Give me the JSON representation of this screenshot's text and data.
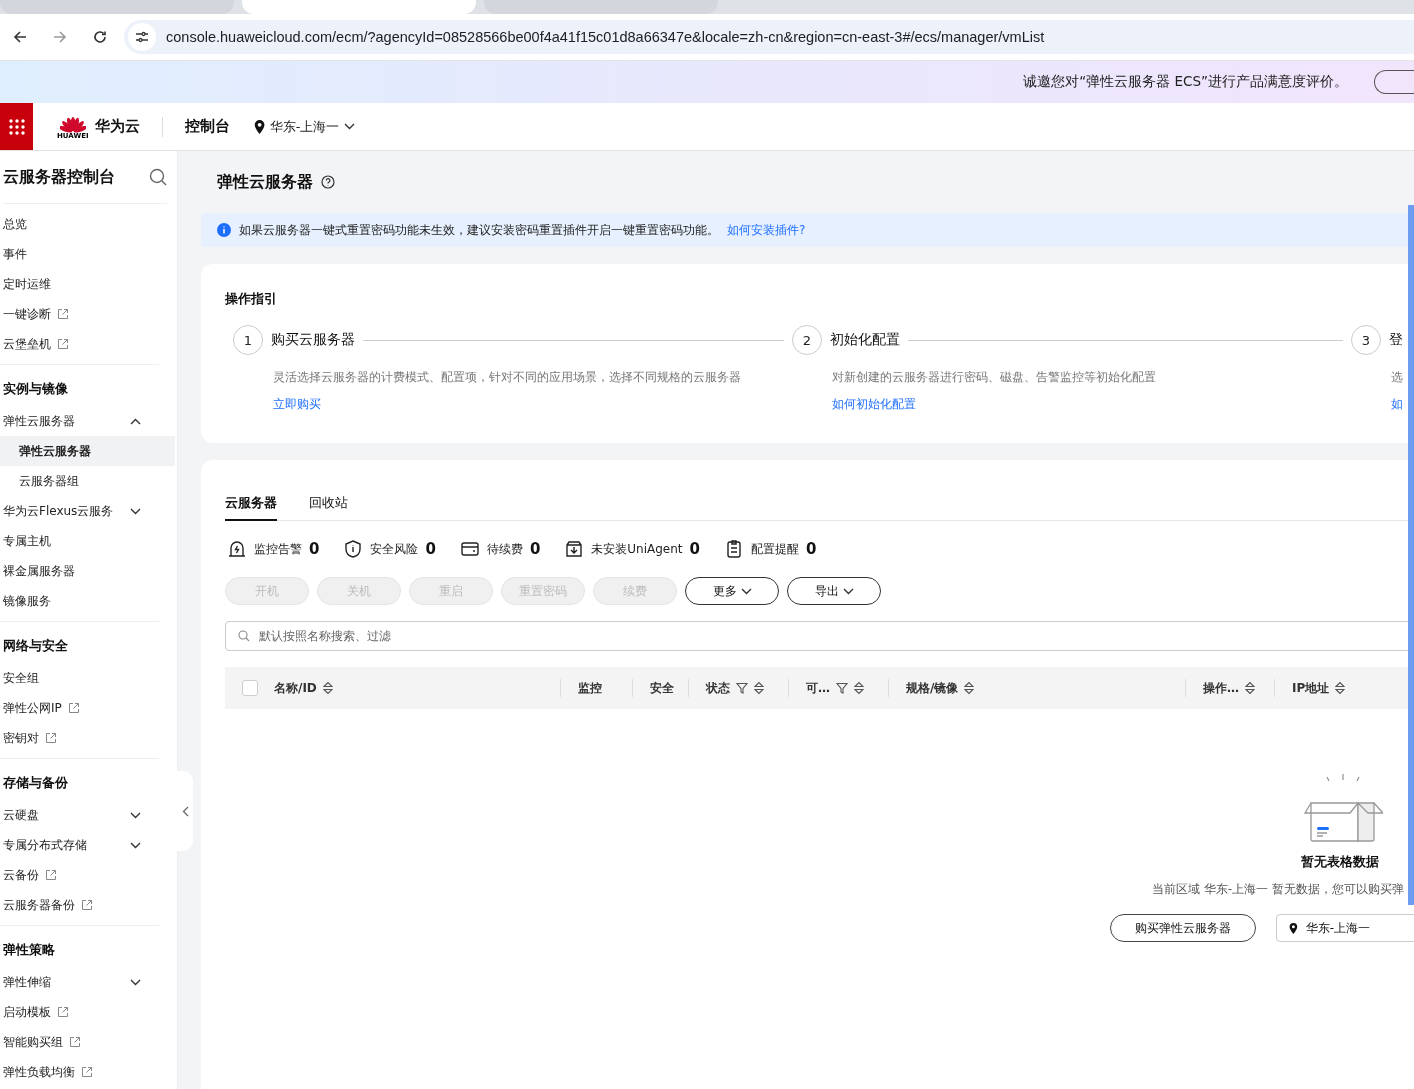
{
  "browser": {
    "tabs": [
      {
        "selected": false
      },
      {
        "selected": true
      },
      {
        "selected": false
      }
    ],
    "url": "console.huaweicloud.com/ecm/?agencyId=08528566be00f4a41f15c01d8a66347e&locale=zh-cn&region=cn-east-3#/ecs/manager/vmList"
  },
  "banner": {
    "text": "诚邀您对“弹性云服务器 ECS”进行产品满意度评价。"
  },
  "header": {
    "brand": "华为云",
    "logo_caption": "HUAWEI",
    "console": "控制台",
    "region": "华东-上海一"
  },
  "sidebar": {
    "title": "云服务器控制台",
    "groups": [
      {
        "items": [
          {
            "label": "总览",
            "kind": "plain"
          },
          {
            "label": "事件",
            "kind": "plain"
          },
          {
            "label": "定时运维",
            "kind": "plain"
          },
          {
            "label": "一键诊断",
            "kind": "external"
          },
          {
            "label": "云堡垒机",
            "kind": "external"
          }
        ]
      },
      {
        "title": "实例与镜像",
        "items": [
          {
            "label": "弹性云服务器",
            "kind": "expandable",
            "expanded": true,
            "children": [
              {
                "label": "弹性云服务器",
                "selected": true
              },
              {
                "label": "云服务器组",
                "selected": false
              }
            ]
          },
          {
            "label": "华为云Flexus云服务",
            "kind": "expandable",
            "expanded": false
          },
          {
            "label": "专属主机",
            "kind": "plain"
          },
          {
            "label": "裸金属服务器",
            "kind": "plain"
          },
          {
            "label": "镜像服务",
            "kind": "plain"
          }
        ]
      },
      {
        "title": "网络与安全",
        "items": [
          {
            "label": "安全组",
            "kind": "plain"
          },
          {
            "label": "弹性公网IP",
            "kind": "external"
          },
          {
            "label": "密钥对",
            "kind": "external"
          }
        ]
      },
      {
        "title": "存储与备份",
        "items": [
          {
            "label": "云硬盘",
            "kind": "expandable",
            "expanded": false
          },
          {
            "label": "专属分布式存储",
            "kind": "expandable",
            "expanded": false
          },
          {
            "label": "云备份",
            "kind": "external"
          },
          {
            "label": "云服务器备份",
            "kind": "external"
          }
        ]
      },
      {
        "title": "弹性策略",
        "items": [
          {
            "label": "弹性伸缩",
            "kind": "expandable",
            "expanded": false
          },
          {
            "label": "启动模板",
            "kind": "external"
          },
          {
            "label": "智能购买组",
            "kind": "external"
          },
          {
            "label": "弹性负载均衡",
            "kind": "external"
          }
        ]
      }
    ]
  },
  "page": {
    "title": "弹性云服务器",
    "alert": {
      "text": "如果云服务器一键式重置密码功能未生效，建议安装密码重置插件开启一键重置密码功能。",
      "link": "如何安装插件?"
    },
    "guide": {
      "title": "操作指引",
      "steps": [
        {
          "number": "1",
          "title": "购买云服务器",
          "description": "灵活选择云服务器的计费模式、配置项，针对不同的应用场景，选择不同规格的云服务器",
          "link": "立即购买"
        },
        {
          "number": "2",
          "title": "初始化配置",
          "description": "对新创建的云服务器进行密码、磁盘、告警监控等初始化配置",
          "link": "如何初始化配置"
        },
        {
          "number": "3",
          "title": "登",
          "description": "选",
          "link": "如"
        }
      ]
    },
    "tabs": [
      {
        "label": "云服务器",
        "selected": true
      },
      {
        "label": "回收站",
        "selected": false
      }
    ],
    "stats": [
      {
        "kind": "alarm",
        "label": "监控告警",
        "count": "0"
      },
      {
        "kind": "risk",
        "label": "安全风险",
        "count": "0"
      },
      {
        "kind": "renew",
        "label": "待续费",
        "count": "0"
      },
      {
        "kind": "agent",
        "label": "未安装UniAgent",
        "count": "0"
      },
      {
        "kind": "config",
        "label": "配置提醒",
        "count": "0"
      }
    ],
    "actions": [
      {
        "label": "开机",
        "disabled": true,
        "dropdown": false
      },
      {
        "label": "关机",
        "disabled": true,
        "dropdown": false
      },
      {
        "label": "重启",
        "disabled": true,
        "dropdown": false
      },
      {
        "label": "重置密码",
        "disabled": true,
        "dropdown": false
      },
      {
        "label": "续费",
        "disabled": true,
        "dropdown": false
      },
      {
        "label": "更多",
        "disabled": false,
        "dropdown": true
      },
      {
        "label": "导出",
        "disabled": false,
        "dropdown": true
      }
    ],
    "search": {
      "placeholder": "默认按照名称搜索、过滤"
    },
    "table": {
      "select_all": {
        "checked": false
      },
      "columns": [
        {
          "label": "名称/ID",
          "filterable": false,
          "sortable": true
        },
        {
          "label": "监控",
          "filterable": false,
          "sortable": false
        },
        {
          "label": "安全",
          "filterable": false,
          "sortable": false
        },
        {
          "label": "状态",
          "filterable": true,
          "sortable": true
        },
        {
          "label": "可…",
          "filterable": true,
          "sortable": true
        },
        {
          "label": "规格/镜像",
          "filterable": false,
          "sortable": true
        },
        {
          "label": "操作…",
          "filterable": false,
          "sortable": true
        },
        {
          "label": "IP地址",
          "filterable": false,
          "sortable": true
        }
      ],
      "empty": {
        "title": "暂无表格数据",
        "text": "当前区域 华东-上海一 暂无数据，您可以购买弹",
        "button": "购买弹性云服务器",
        "region": "华东-上海一"
      }
    }
  }
}
